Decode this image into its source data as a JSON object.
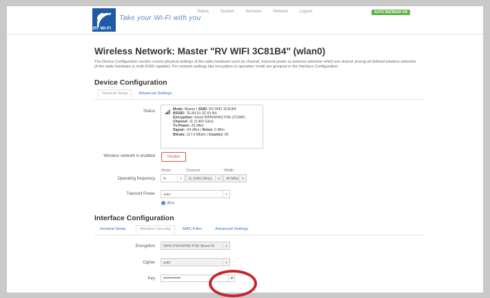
{
  "brand": {
    "logo_text": "RV WI-FI",
    "tagline": "Take your Wi-Fi with you"
  },
  "nav": {
    "items": [
      "Status",
      "System",
      "Services",
      "Network",
      "Logout"
    ],
    "autorefresh": "AUTO REFRESH ON"
  },
  "page": {
    "title": "Wireless Network: Master \"RV WIFI 3C81B4\" (wlan0)",
    "description": "The Device Configuration section covers physical settings of the radio hardware such as channel, transmit power or antenna selection which are shared among all defined wireless networks (if the radio hardware is multi-SSID capable). Per network settings like encryption or operation mode are grouped in the Interface Configuration."
  },
  "device_config": {
    "heading": "Device Configuration",
    "tabs": [
      "General Setup",
      "Advanced Settings"
    ],
    "status_label": "Status",
    "status_lines": [
      {
        "k": "Mode:",
        "v": " Master | ",
        "k2": "SSID:",
        "v2": " RV WIFI 3C81B4"
      },
      {
        "k": "BSSID:",
        "v": " 7E:A3:51:3C:81:B4",
        "k2": "",
        "v2": ""
      },
      {
        "k": "Encryption:",
        "v": " mixed WPA/WPA2 PSK (CCMP)",
        "k2": "",
        "v2": ""
      },
      {
        "k": "Channel:",
        "v": " 11 (2.462 GHz)",
        "k2": "",
        "v2": ""
      },
      {
        "k": "Tx-Power:",
        "v": " 20 dBm",
        "k2": "",
        "v2": ""
      },
      {
        "k": "Signal:",
        "v": " -64 dBm | ",
        "k2": "Noise:",
        "v2": " 0 dBm"
      },
      {
        "k": "Bitrate:",
        "v": " 117.0 Mbit/s | ",
        "k2": "Country:",
        "v2": " 00"
      }
    ],
    "wireless_enabled_label": "Wireless network is enabled",
    "disable_button": "Disable",
    "freq_label": "Operating frequency",
    "mode_label": "Mode",
    "channel_label": "Channel",
    "width_label": "Width",
    "mode_value": "N",
    "channel_value": "11 (2462 MHz)",
    "width_value": "40 MHz",
    "tx_label": "Transmit Power",
    "tx_value": "auto",
    "tx_unit": "dBm"
  },
  "interface_config": {
    "heading": "Interface Configuration",
    "tabs": [
      "General Setup",
      "Wireless Security",
      "MAC-Filter",
      "Advanced Settings"
    ],
    "encryption_label": "Encryption",
    "encryption_value": "WPA-PSK/WPA2-PSK Mixed M",
    "cipher_label": "Cipher",
    "cipher_value": "auto",
    "key_label": "Key",
    "key_value": "••••••••••••"
  },
  "colors": {
    "accent": "#2f73c9",
    "highlight": "#c8242b",
    "autorefresh": "#62b345",
    "logo": "#1e5aa8"
  }
}
